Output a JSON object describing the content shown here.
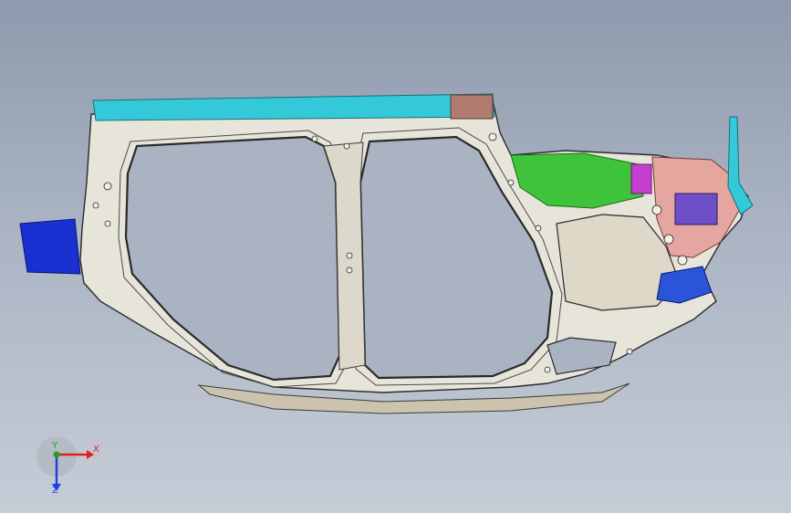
{
  "viewport": {
    "part": "body-side-assembly",
    "colors": {
      "surface": "#e7e4da",
      "edge": "#2a2a2a",
      "cyan": "#33c9d8",
      "blue": "#1a2fd0",
      "green": "#3fc33a",
      "magenta": "#c43fd0",
      "pink": "#e6a6a0",
      "sill": "#cfc7b2"
    }
  },
  "triad": {
    "x_label": "X",
    "y_label": "Y",
    "z_label": "Z",
    "x_color": "#e02020",
    "y_color": "#20a020",
    "z_color": "#2040e0"
  }
}
